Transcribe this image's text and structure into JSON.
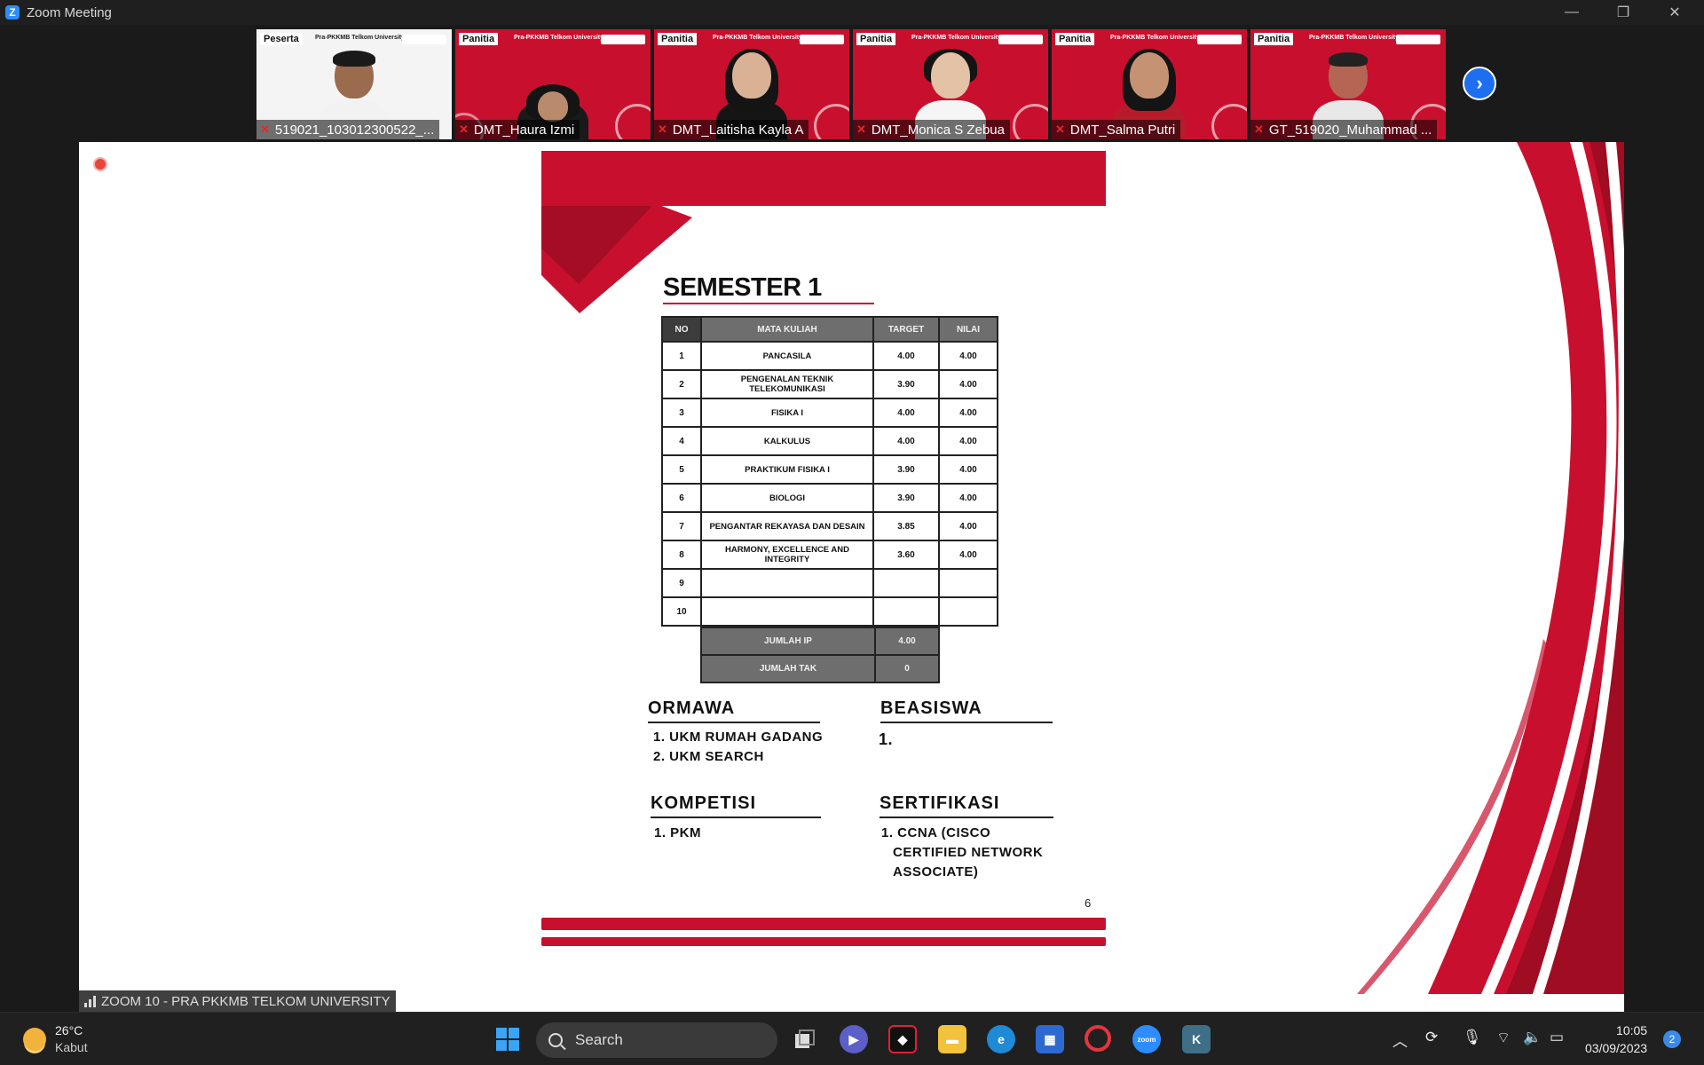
{
  "window": {
    "title": "Zoom Meeting",
    "minimize": "—",
    "restore": "❐",
    "close": "✕"
  },
  "gallery": {
    "tiles": [
      {
        "role": "Peserta",
        "name": "519021_103012300522_...",
        "style": "white"
      },
      {
        "role": "Panitia",
        "name": "DMT_Haura Izmi",
        "style": "red"
      },
      {
        "role": "Panitia",
        "name": "DMT_Laitisha Kayla A",
        "style": "red"
      },
      {
        "role": "Panitia",
        "name": "DMT_Monica S Zebua",
        "style": "red"
      },
      {
        "role": "Panitia",
        "name": "DMT_Salma Putri",
        "style": "red"
      },
      {
        "role": "Panitia",
        "name": "GT_519020_Muhammad ...",
        "style": "red"
      }
    ],
    "banner_text": "Pra-PKKMB Telkom University 2023",
    "next_arrow": "›"
  },
  "slide": {
    "title": "SEMESTER 1",
    "table": {
      "headers": [
        "NO",
        "MATA KULIAH",
        "TARGET",
        "NILAI"
      ],
      "rows": [
        {
          "no": "1",
          "course": "PANCASILA",
          "target": "4.00",
          "value": "4.00"
        },
        {
          "no": "2",
          "course": "PENGENALAN TEKNIK TELEKOMUNIKASI",
          "target": "3.90",
          "value": "4.00"
        },
        {
          "no": "3",
          "course": "FISIKA I",
          "target": "4.00",
          "value": "4.00"
        },
        {
          "no": "4",
          "course": "KALKULUS",
          "target": "4.00",
          "value": "4.00"
        },
        {
          "no": "5",
          "course": "PRAKTIKUM FISIKA I",
          "target": "3.90",
          "value": "4.00"
        },
        {
          "no": "6",
          "course": "BIOLOGI",
          "target": "3.90",
          "value": "4.00"
        },
        {
          "no": "7",
          "course": "PENGANTAR REKAYASA DAN DESAIN",
          "target": "3.85",
          "value": "4.00"
        },
        {
          "no": "8",
          "course": "HARMONY, EXCELLENCE AND INTEGRITY",
          "target": "3.60",
          "value": "4.00"
        },
        {
          "no": "9",
          "course": "",
          "target": "",
          "value": ""
        },
        {
          "no": "10",
          "course": "",
          "target": "",
          "value": ""
        }
      ],
      "summary": [
        {
          "label": "JUMLAH IP",
          "value": "4.00"
        },
        {
          "label": "JUMLAH TAK",
          "value": "0"
        }
      ]
    },
    "ormawa": {
      "heading": "ORMAWA",
      "items": [
        "1. UKM RUMAH GADANG",
        "2. UKM SEARCH"
      ]
    },
    "beasiswa": {
      "heading": "BEASISWA",
      "items": [
        "1."
      ]
    },
    "kompetisi": {
      "heading": "KOMPETISI",
      "items": [
        "1. PKM"
      ]
    },
    "sertifikasi": {
      "heading": "SERTIFIKASI",
      "items": [
        "1. CCNA (CISCO",
        "CERTIFIED NETWORK",
        "ASSOCIATE)"
      ]
    },
    "page_number": "6"
  },
  "meeting_label": "ZOOM 10 - PRA PKKMB TELKOM UNIVERSITY",
  "taskbar": {
    "weather_temp": "26°C",
    "weather_condition": "Kabut",
    "search_placeholder": "Search",
    "time": "10:05",
    "date": "03/09/2023",
    "notification_count": "2"
  },
  "colors": {
    "accent_red": "#c8102e",
    "zoom_blue": "#2d8cff"
  }
}
